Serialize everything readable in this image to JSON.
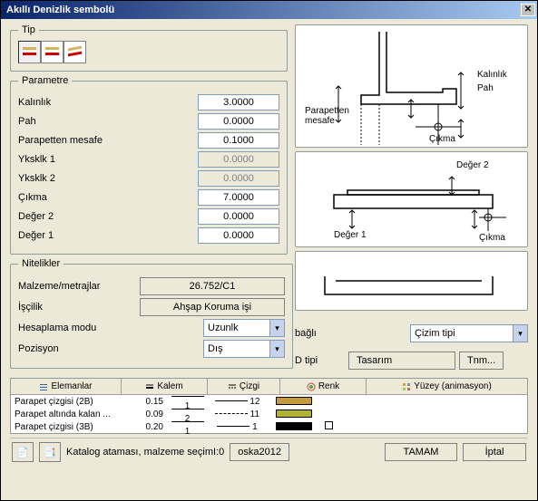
{
  "title": "Akıllı Denizlik sembolü",
  "tip": {
    "legend": "Tip"
  },
  "parametre": {
    "legend": "Parametre",
    "rows": [
      {
        "label": "Kalınlık",
        "value": "3.0000",
        "readonly": false
      },
      {
        "label": "Pah",
        "value": "0.0000",
        "readonly": false
      },
      {
        "label": "Parapetten mesafe",
        "value": "0.1000",
        "readonly": false
      },
      {
        "label": "Yksklk 1",
        "value": "0.0000",
        "readonly": true
      },
      {
        "label": "Yksklk 2",
        "value": "0.0000",
        "readonly": true
      },
      {
        "label": "Çıkma",
        "value": "7.0000",
        "readonly": false
      },
      {
        "label": "Değer 2",
        "value": "0.0000",
        "readonly": false
      },
      {
        "label": "Değer 1",
        "value": "0.0000",
        "readonly": false
      }
    ]
  },
  "nitelikler": {
    "legend": "Nitelikler",
    "malzeme_label": "Malzeme/metrajlar",
    "malzeme_value": "26.752/C1",
    "iscilik_label": "İşçilik",
    "iscilik_value": "Ahşap Koruma işi",
    "hesap_label": "Hesaplama modu",
    "hesap_value": "Uzunlk",
    "pozisyon_label": "Pozisyon",
    "pozisyon_value": "Dış"
  },
  "right": {
    "bagli_label": "bağlı",
    "bagli_value": "Çizim tipi",
    "dtipi_label": "D tipi",
    "dtipi_value": "Tasarım",
    "tnm_btn": "Tnm...",
    "diag_labels": {
      "kalinlik": "Kalınlık",
      "pah": "Pah",
      "cikma": "Çıkma",
      "parapet": "Parapetten\nmesafe",
      "deger1": "Değer 1",
      "deger2": "Değer 2"
    }
  },
  "grid": {
    "headers": {
      "elemanlar": "Elemanlar",
      "kalem": "Kalem",
      "cizgi": "Çizgi",
      "renk": "Renk",
      "yuzey": "Yüzey (animasyon)"
    },
    "rows": [
      {
        "name": "Parapet çizgisi (2B)",
        "kalem": "0.15",
        "kk": "1",
        "cizgi": "12",
        "color": "#C49A3A"
      },
      {
        "name": "Parapet altında kalan ...",
        "kalem": "0.09",
        "kk": "2",
        "cizgi": "11",
        "color": "#B2B235"
      },
      {
        "name": "Parapet çizgisi (3B)",
        "kalem": "0.20",
        "kk": "1",
        "cizgi": "1",
        "color": "#000000"
      }
    ]
  },
  "bottom": {
    "katalog": "Katalog ataması, malzeme seçimI:0",
    "oska": "oska2012",
    "tamam": "TAMAM",
    "iptal": "İptal"
  }
}
